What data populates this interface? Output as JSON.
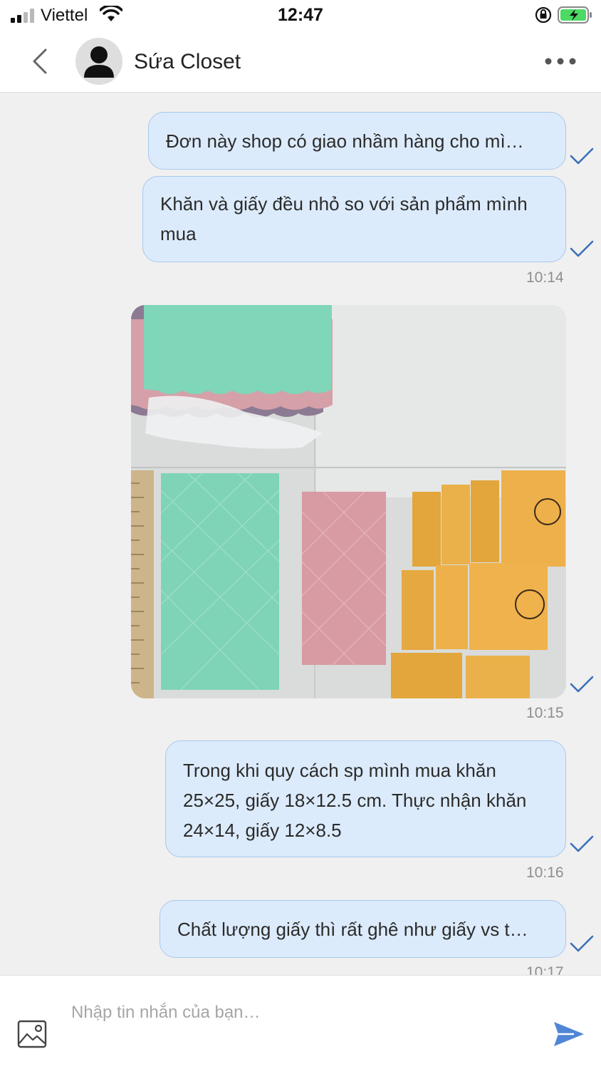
{
  "status_bar": {
    "carrier": "Viettel",
    "time": "12:47",
    "icons": [
      "signal-icon",
      "wifi-icon",
      "rotation-lock-icon",
      "battery-charging-icon"
    ]
  },
  "header": {
    "back_icon": "chevron-left-icon",
    "avatar_icon": "user-silhouette-icon",
    "contact_name": "Sứa Closet",
    "more_icon": "ellipsis-icon"
  },
  "messages": [
    {
      "text": "Đơn này shop có giao nhầm hàng cho mì…",
      "status": "sent"
    },
    {
      "text": "Khăn và giấy đều nhỏ so với sản phẩm mình mua",
      "status": "sent",
      "time": "10:14"
    },
    {
      "type": "image",
      "status": "sent",
      "time": "10:15"
    },
    {
      "text": "Trong khi quy cách sp mình mua khăn 25×25, giấy 18×12.5 cm. Thực nhận khăn 24×14, giấy 12×8.5",
      "status": "sent",
      "time": "10:16"
    },
    {
      "text": "Chất lượng giấy thì rất ghê như giấy vs t…",
      "status": "sent",
      "time": "10:17"
    }
  ],
  "input": {
    "placeholder": "Nhập tin nhắn của bạn…",
    "value": "",
    "image_icon": "image-icon",
    "send_icon": "send-icon"
  },
  "colors": {
    "bubble_bg": "#dcebfb",
    "bubble_border": "#a8c8ec",
    "tick": "#3a6fb8",
    "send": "#4f86d6"
  }
}
